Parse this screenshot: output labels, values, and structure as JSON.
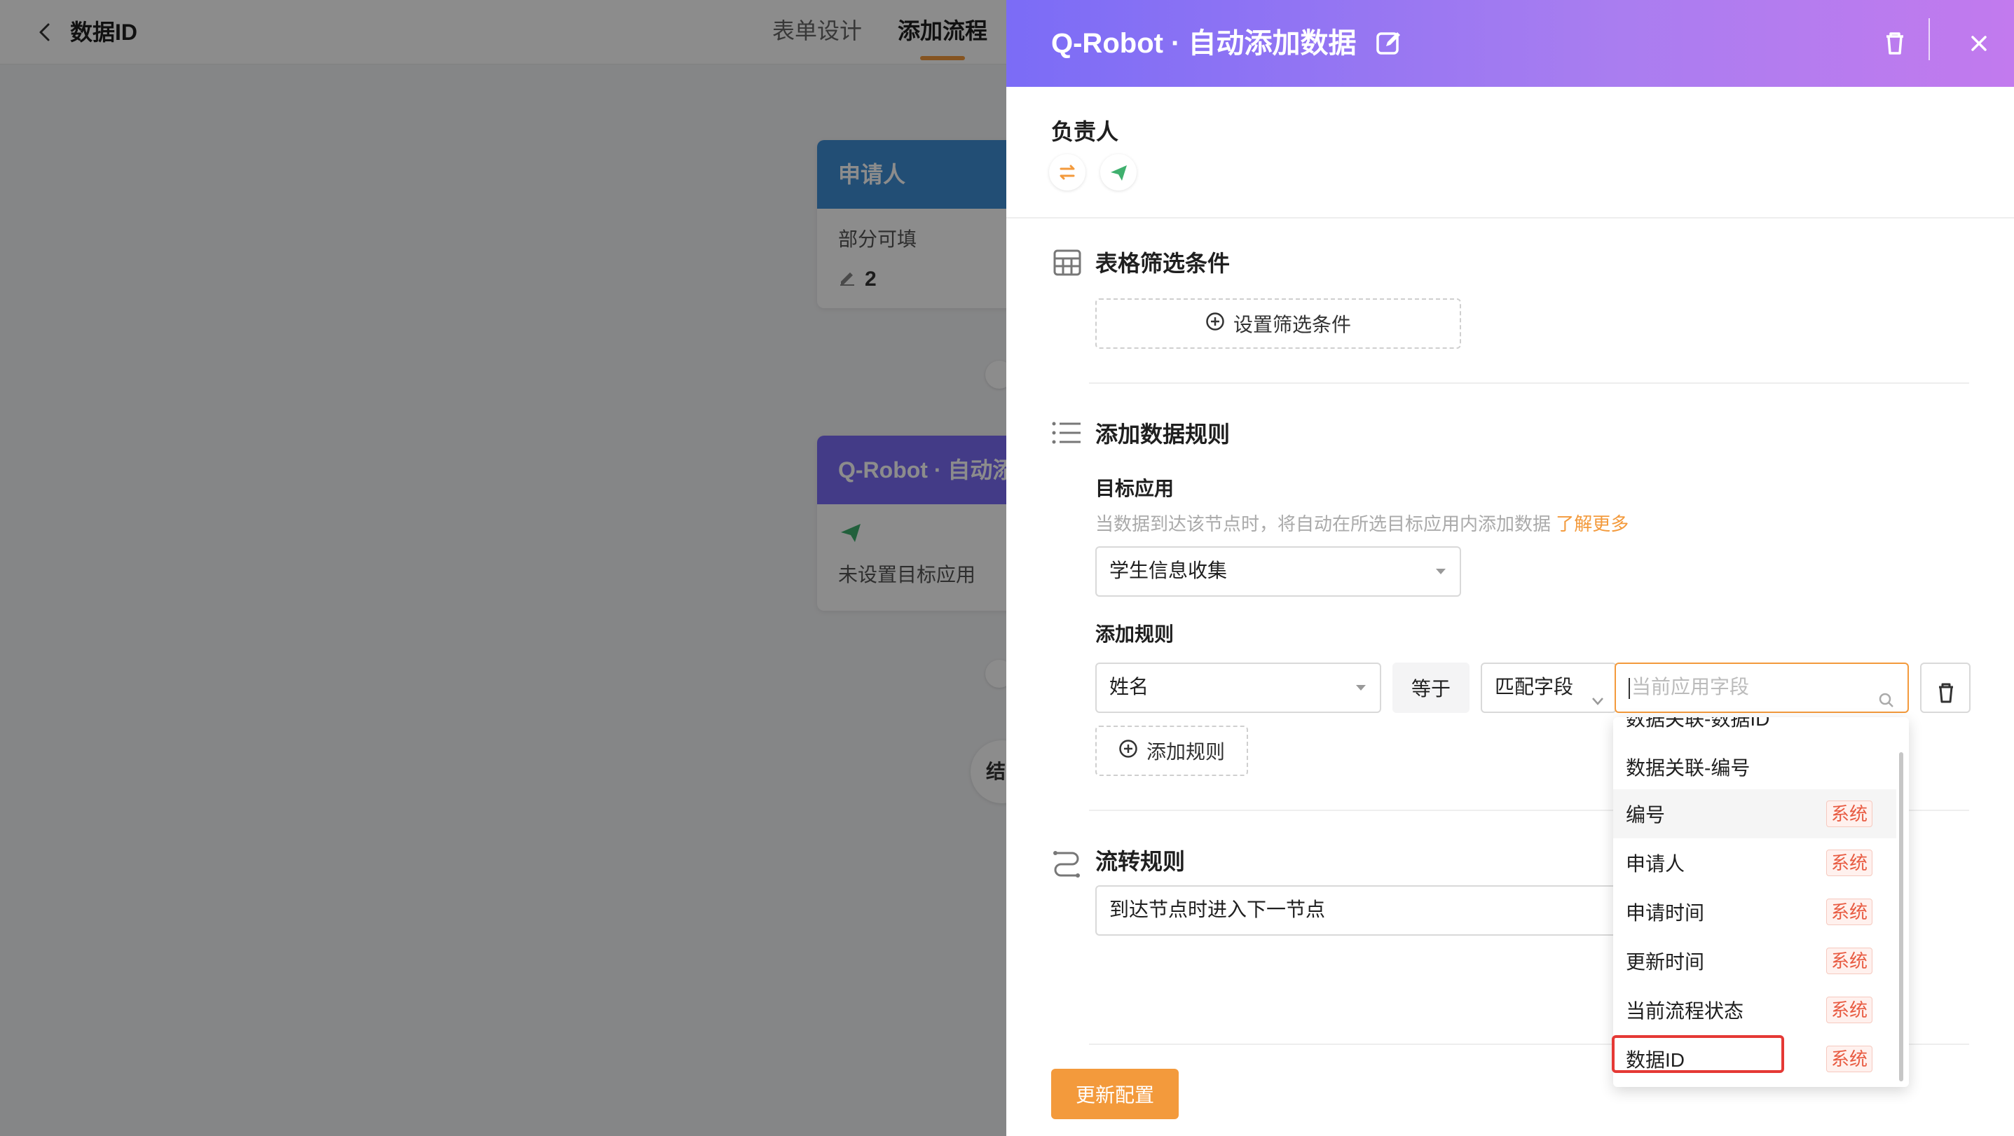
{
  "app": {
    "title": "数据ID",
    "tabs": [
      {
        "label": "表单设计"
      },
      {
        "label": "添加流程"
      }
    ]
  },
  "flow": {
    "applicant_node": {
      "title": "申请人",
      "desc": "部分可填",
      "edit_count": "2"
    },
    "robot_node": {
      "title": "Q-Robot · 自动添",
      "desc": "未设置目标应用"
    },
    "end_node": {
      "label": "结"
    }
  },
  "drawer": {
    "title": "Q-Robot · 自动添加数据",
    "owner_label": "负责人",
    "filter": {
      "label": "表格筛选条件",
      "button": "设置筛选条件"
    },
    "rules": {
      "label": "添加数据规则",
      "target_app_label": "目标应用",
      "target_app_hint": "当数据到达该节点时，将自动在所选目标应用内添加数据",
      "learn_more": "了解更多",
      "target_app_value": "学生信息收集",
      "add_rule_label": "添加规则",
      "rule_field": "姓名",
      "rule_operator": "等于",
      "rule_match_type": "匹配字段",
      "rule_value_placeholder": "当前应用字段",
      "add_rule_button": "添加规则"
    },
    "flow_rule": {
      "label": "流转规则",
      "value": "到达节点时进入下一节点"
    },
    "submit": "更新配置"
  },
  "dropdown": {
    "items": [
      {
        "label": "数据关联-数据ID",
        "tag": ""
      },
      {
        "label": "数据关联-编号",
        "tag": ""
      },
      {
        "label": "编号",
        "tag": "系统"
      },
      {
        "label": "申请人",
        "tag": "系统"
      },
      {
        "label": "申请时间",
        "tag": "系统"
      },
      {
        "label": "更新时间",
        "tag": "系统"
      },
      {
        "label": "当前流程状态",
        "tag": "系统"
      },
      {
        "label": "数据ID",
        "tag": "系统"
      }
    ]
  },
  "colors": {
    "accent": "#f39a3c",
    "header_gradient_start": "#7b6cf6",
    "header_gradient_end": "#c27aee",
    "applicant_node": "#3f8fd6",
    "robot_node": "#7b6cf6",
    "system_tag": "#e85b42",
    "highlight": "#e53935"
  }
}
